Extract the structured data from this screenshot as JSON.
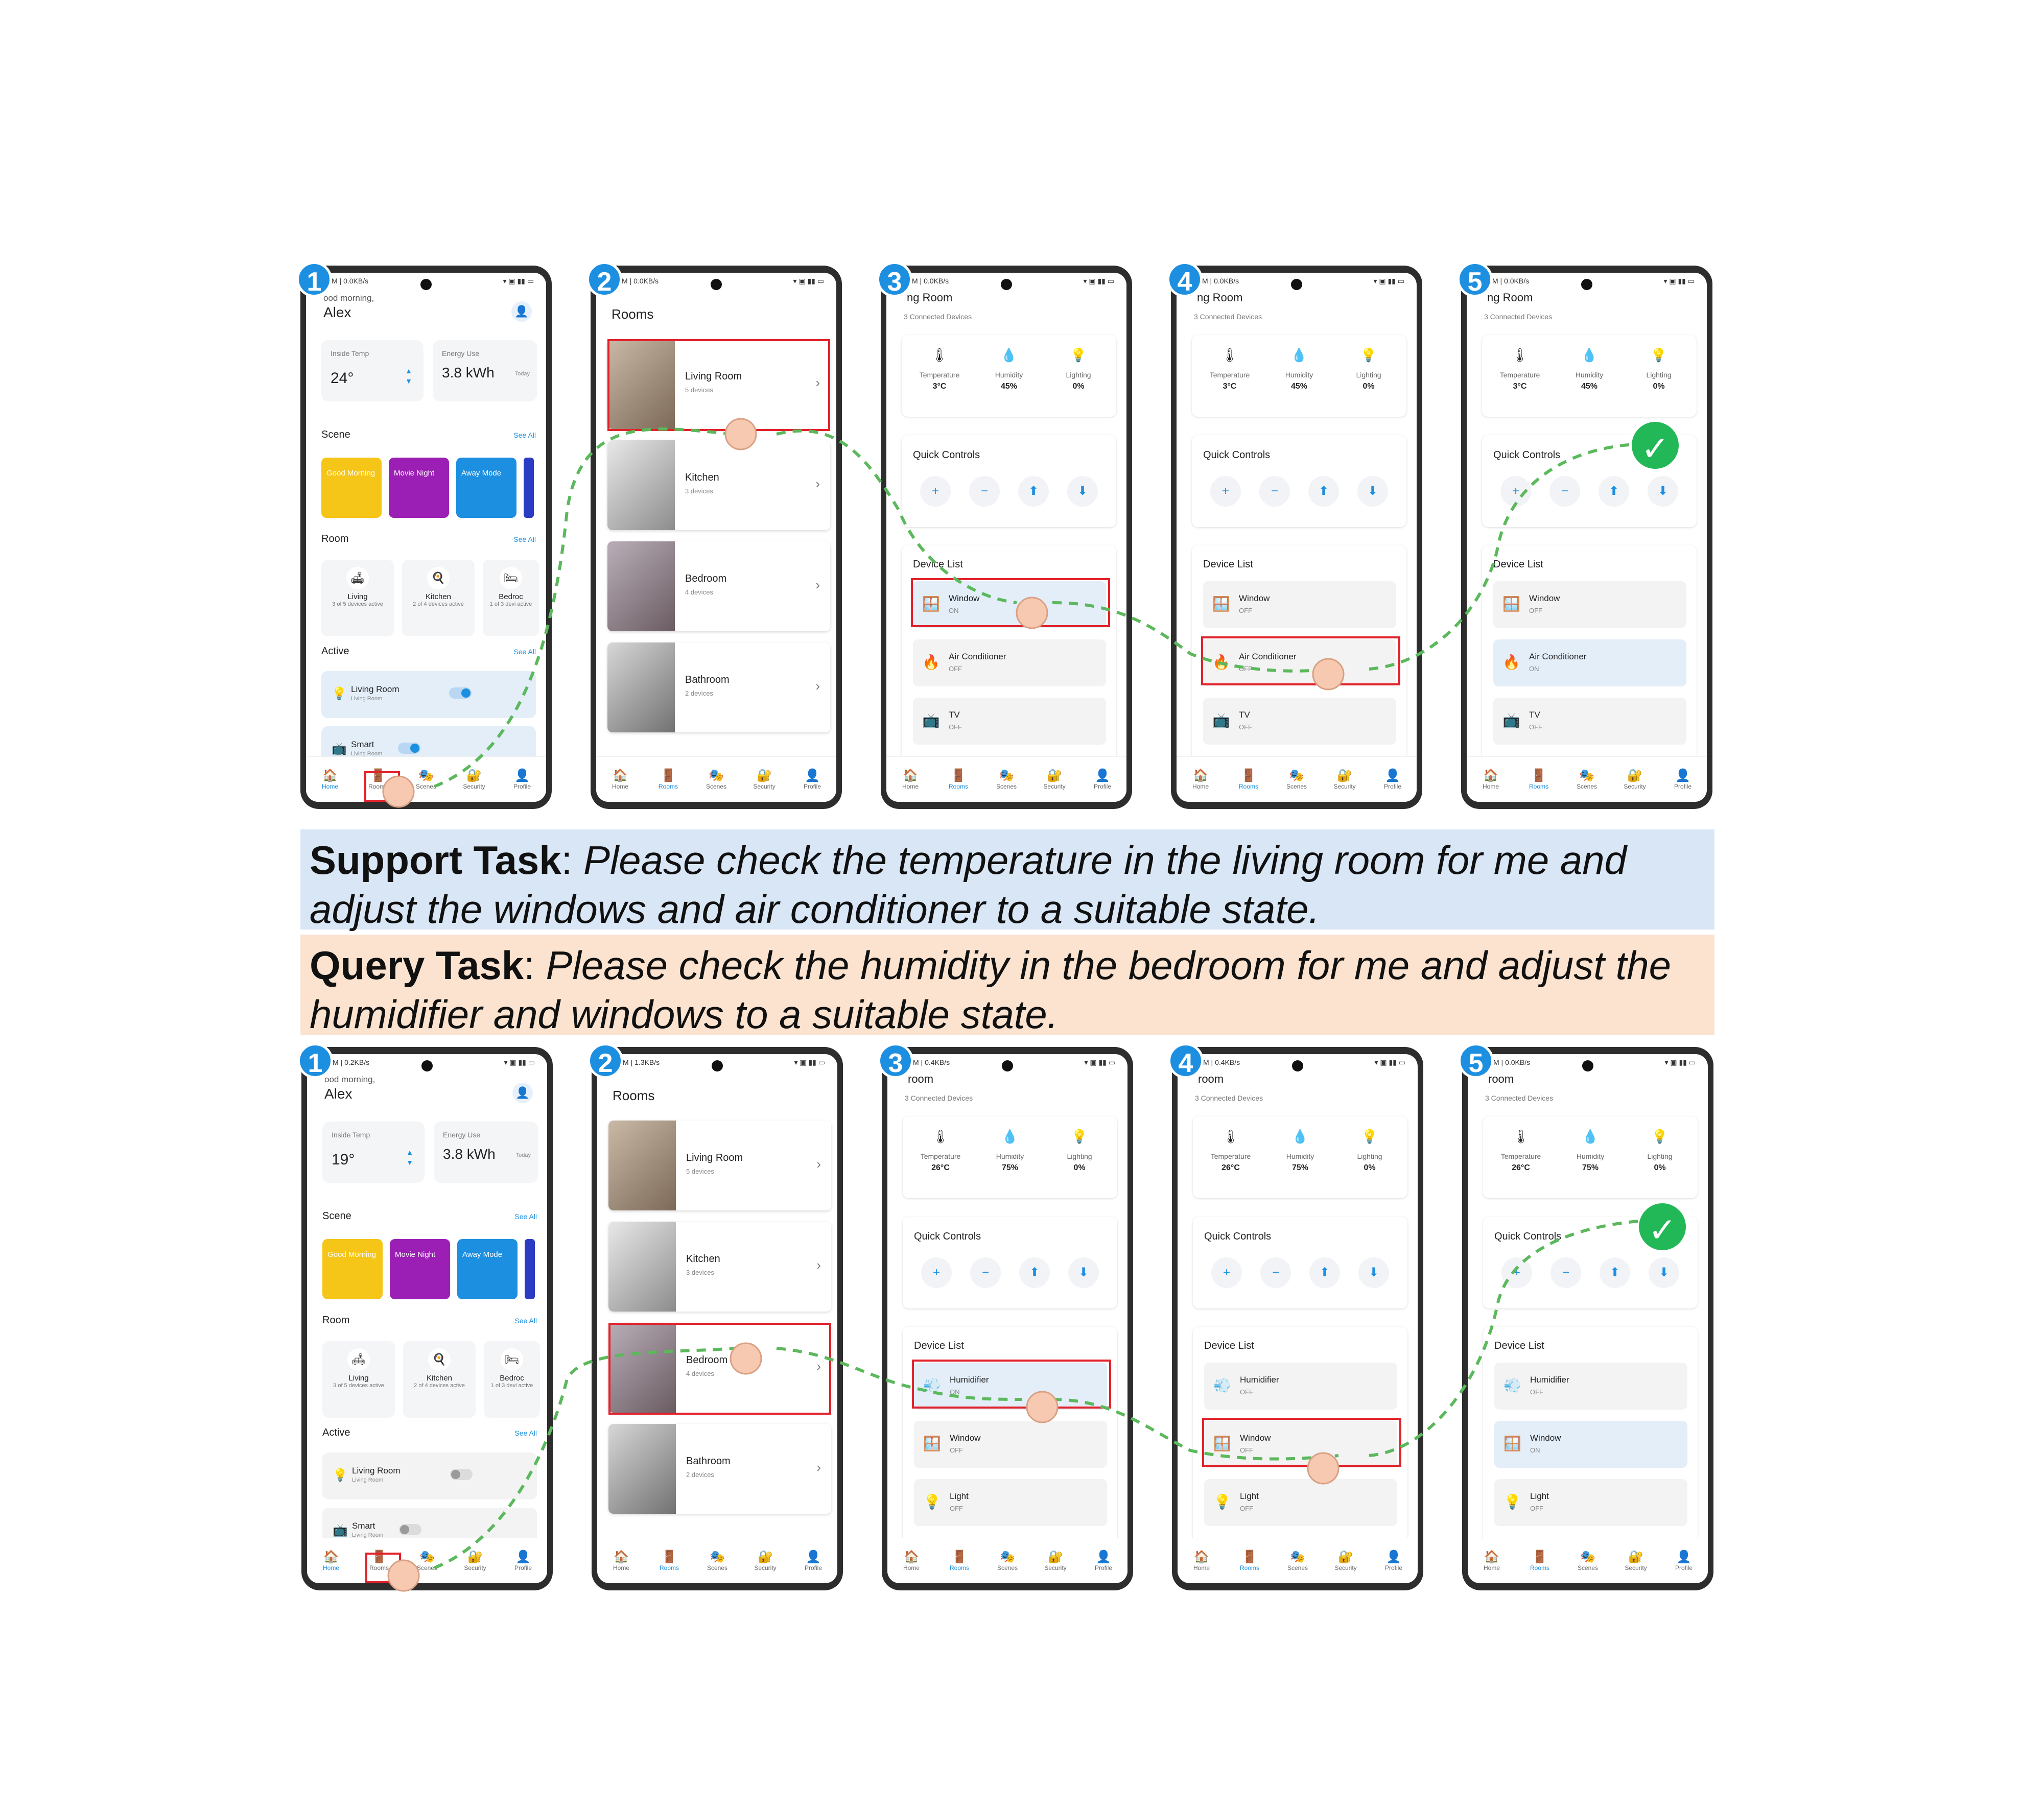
{
  "status_bars": {
    "top": [
      "M | 0.0KB/s",
      "M | 0.0KB/s",
      "M | 0.0KB/s",
      "M | 0.0KB/s",
      "M | 0.0KB/s"
    ],
    "bottom": [
      "M | 0.2KB/s",
      "M | 1.3KB/s",
      "M | 0.4KB/s",
      "M | 0.4KB/s",
      "M | 0.0KB/s"
    ]
  },
  "steps": [
    "1",
    "2",
    "3",
    "4",
    "5"
  ],
  "home": {
    "greeting": "ood morning,",
    "name": "Alex",
    "inside_temp_label": "Inside Temp",
    "energy_label": "Energy Use",
    "energy_value": "3.8 kWh",
    "energy_period": "Today",
    "scene_title": "Scene",
    "see_all": "See All",
    "scenes": [
      {
        "label": "Good Morning",
        "color": "#f5c518"
      },
      {
        "label": "Movie Night",
        "color": "#9b1fb4"
      },
      {
        "label": "Away Mode",
        "color": "#1d8fe1"
      }
    ],
    "room_title": "Room",
    "rooms": [
      {
        "name": "Living",
        "sub": "3 of 5 devices active"
      },
      {
        "name": "Kitchen",
        "sub": "2 of 4 devices active"
      },
      {
        "name": "Bedroc",
        "sub": "1 of 3 devi active"
      }
    ],
    "active_title": "Active",
    "active_items": [
      {
        "name": "Living Room",
        "sub": "Living Room"
      },
      {
        "name": "Smart",
        "sub": "Living Room"
      }
    ]
  },
  "top_home_temp": "24°",
  "bottom_home_temp": "19°",
  "nav": [
    "Home",
    "Rooms",
    "Scenes",
    "Security",
    "Profile"
  ],
  "rooms_list": {
    "title": "Rooms",
    "items": [
      {
        "name": "Living Room",
        "devices": "5 devices"
      },
      {
        "name": "Kitchen",
        "devices": "3 devices"
      },
      {
        "name": "Bedroom",
        "devices": "4 devices"
      },
      {
        "name": "Bathroom",
        "devices": "2 devices"
      }
    ]
  },
  "detail_common": {
    "connected": "3 Connected Devices",
    "temp_label": "Temperature",
    "humidity_label": "Humidity",
    "lighting_label": "Lighting",
    "lighting_value": "0%",
    "quick_controls": "Quick Controls",
    "device_list": "Device List",
    "quick_buttons": [
      "+",
      "−",
      "⬆",
      "⬇"
    ]
  },
  "top_detail": {
    "room_header": "ng Room",
    "temp": "3°C",
    "humidity": "45%",
    "devices": [
      "Window",
      "Air Conditioner",
      "TV"
    ],
    "states": {
      "s3": [
        "ON",
        "OFF",
        "OFF"
      ],
      "s4": [
        "OFF",
        "OFF",
        "OFF"
      ],
      "s5": [
        "OFF",
        "ON",
        "OFF"
      ]
    }
  },
  "bottom_detail": {
    "room_header": "room",
    "temp": "26°C",
    "humidity": "75%",
    "devices": [
      "Humidifier",
      "Window",
      "Light"
    ],
    "states": {
      "s3": [
        "ON",
        "OFF",
        "OFF"
      ],
      "s4": [
        "OFF",
        "OFF",
        "OFF"
      ],
      "s5": [
        "OFF",
        "ON",
        "OFF"
      ]
    }
  },
  "support_task": {
    "label": "Support Task",
    "sep": ":",
    "text": "Please check the temperature in the living room for me and adjust the windows and air conditioner to a suitable state."
  },
  "query_task": {
    "label": "Query Task",
    "sep": ":",
    "text": "Please check the humidity in the bedroom for me and adjust the humidifier and windows to a suitable state."
  },
  "colors": {
    "accent": "#1d8fe1",
    "highlight": "#e2222b",
    "success": "#23b857",
    "support_bg": "#d9e6f6",
    "query_bg": "#fbe3cf",
    "path": "#5cb85c"
  }
}
